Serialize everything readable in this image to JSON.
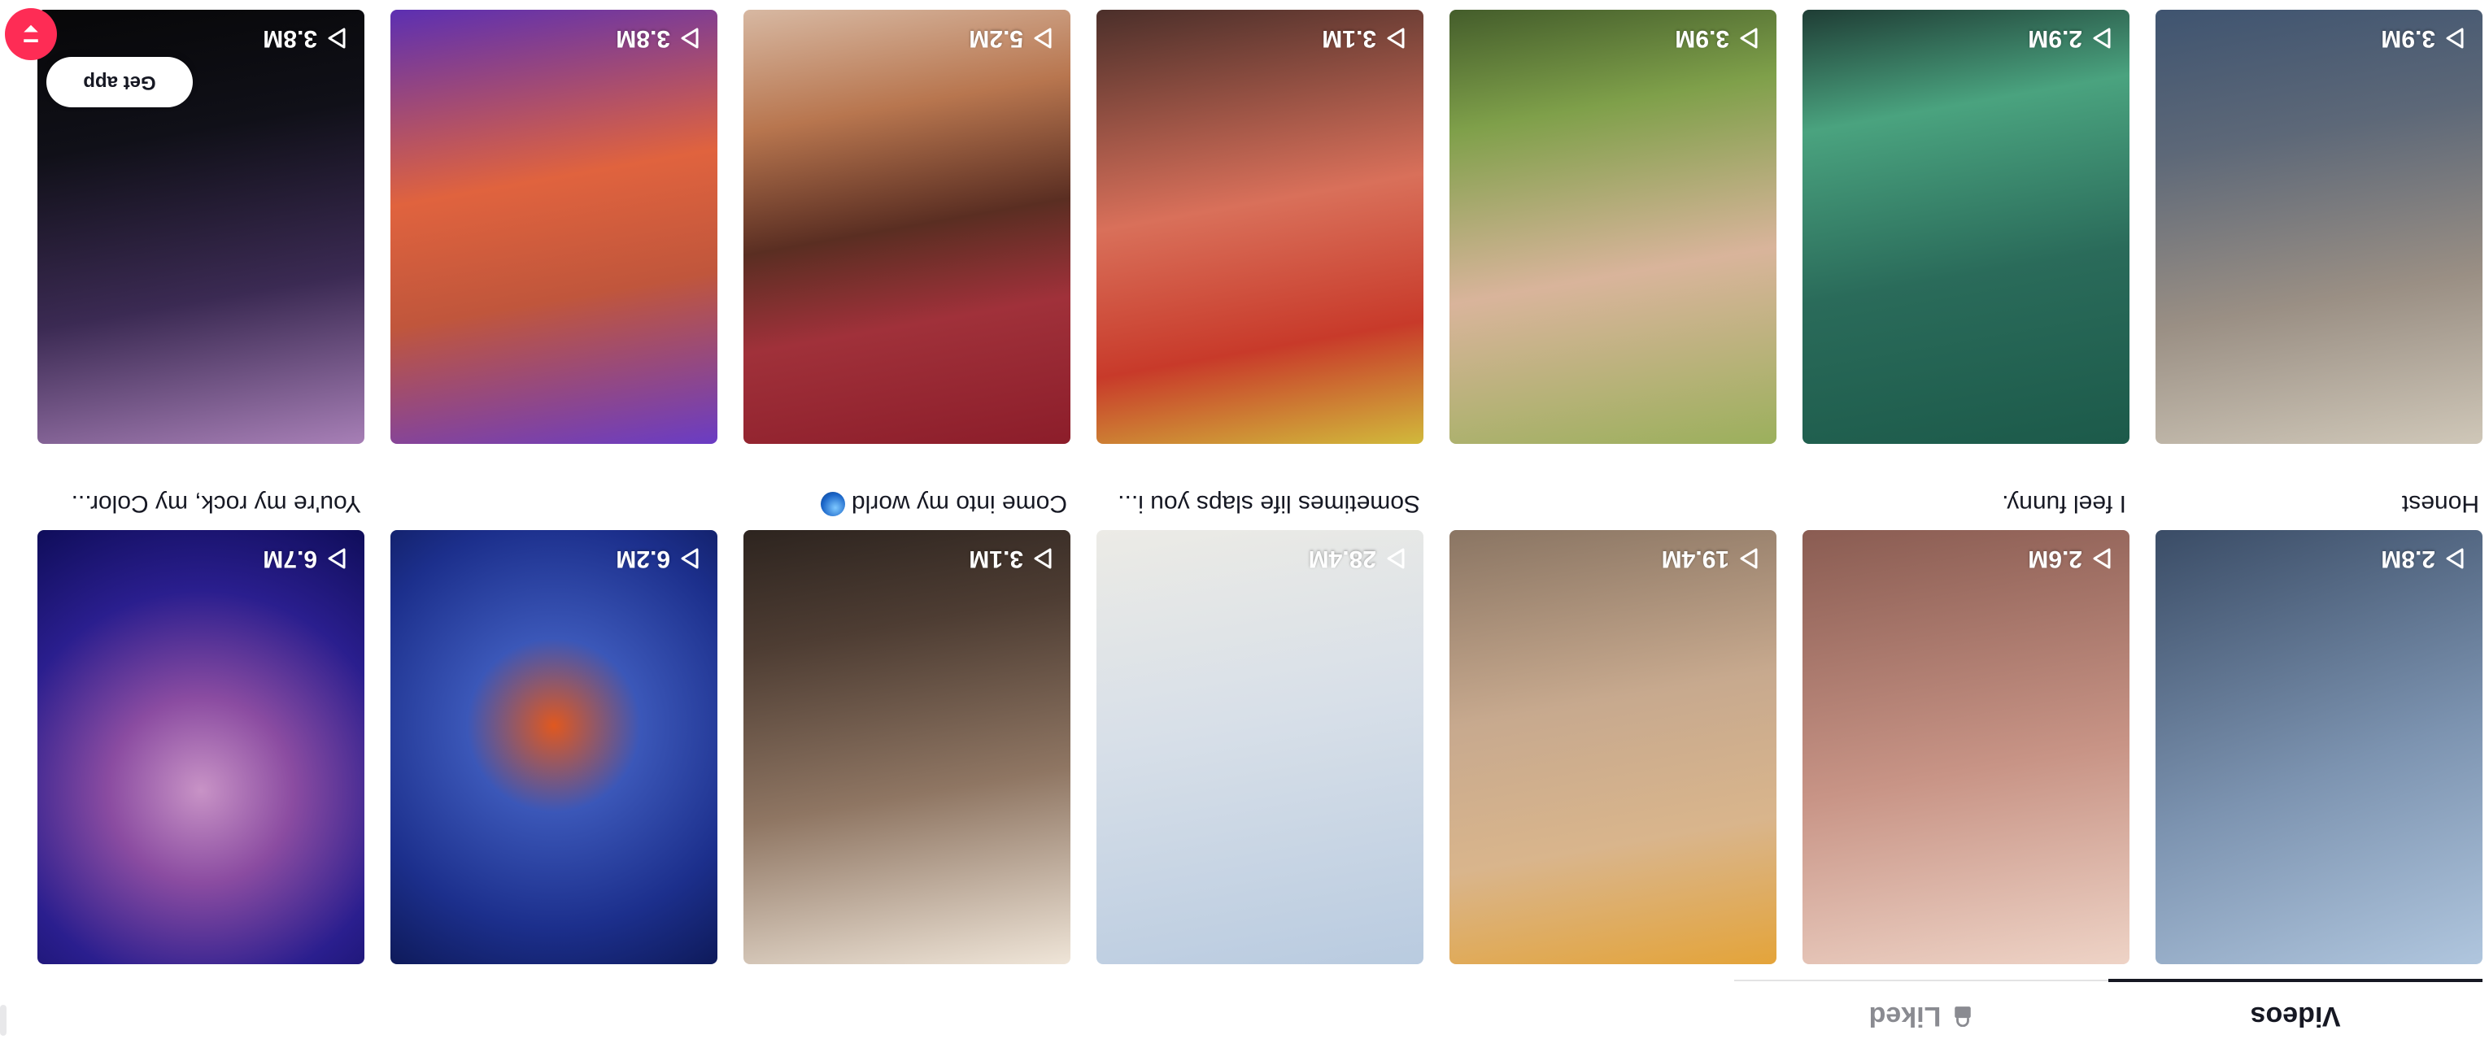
{
  "tabs": {
    "videos": "Videos",
    "liked": "Liked"
  },
  "videos": [
    {
      "views": "2.8M",
      "caption": "Honest"
    },
    {
      "views": "2.6M",
      "caption": "I feel funny."
    },
    {
      "views": "19.4M",
      "caption": ""
    },
    {
      "views": "28.4M",
      "caption": "Sometimes life slaps you i..."
    },
    {
      "views": "3.1M",
      "caption": "Come into my world"
    },
    {
      "views": "6.2M",
      "caption": ""
    },
    {
      "views": "6.7M",
      "caption": "You're my rock, my Color..."
    },
    {
      "views": "3.9M",
      "caption": ""
    },
    {
      "views": "2.9M",
      "caption": ""
    },
    {
      "views": "3.9M",
      "caption": ""
    },
    {
      "views": "3.1M",
      "caption": ""
    },
    {
      "views": "5.2M",
      "caption": ""
    },
    {
      "views": "3.8M",
      "caption": ""
    },
    {
      "views": "3.8M",
      "caption": ""
    }
  ],
  "get_app_label": "Get app",
  "icons": {
    "play": "play-icon",
    "lock": "lock-icon",
    "globe": "globe-icon",
    "badge": "chevron-icon"
  },
  "colors": {
    "accent": "#fe2c55",
    "text": "#161823",
    "muted": "#8a8b91"
  }
}
